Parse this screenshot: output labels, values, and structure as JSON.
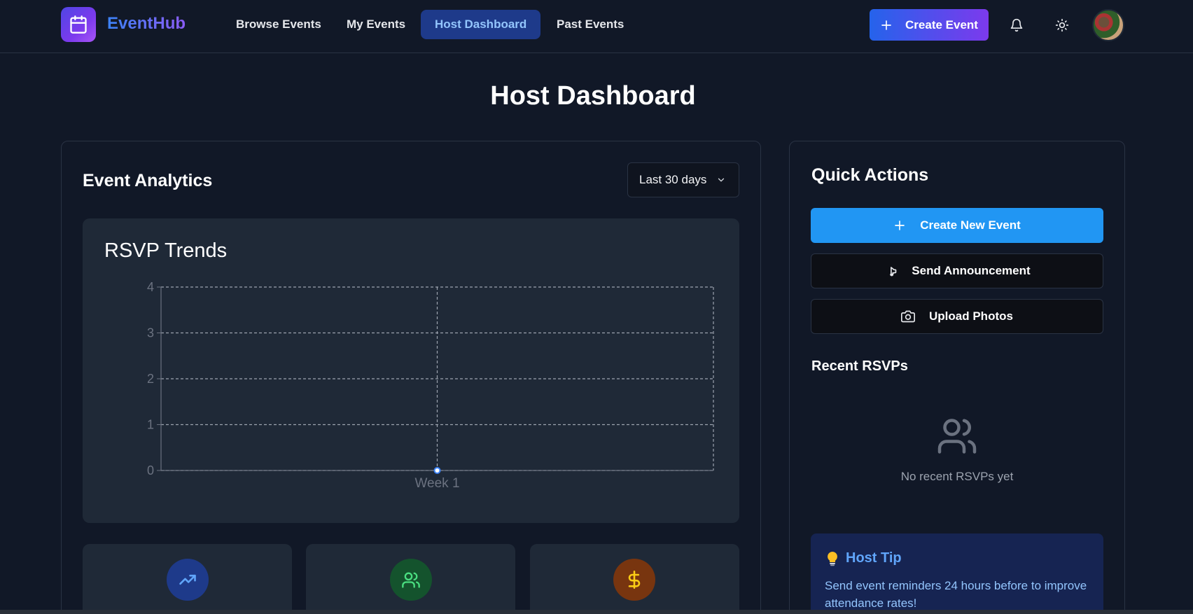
{
  "brand": {
    "name": "EventHub"
  },
  "nav": {
    "items": [
      {
        "label": "Browse Events"
      },
      {
        "label": "My Events"
      },
      {
        "label": "Host Dashboard"
      },
      {
        "label": "Past Events"
      }
    ],
    "active": "Host Dashboard",
    "create_label": "Create Event"
  },
  "header_icons": [
    "bell-icon",
    "sun-icon",
    "avatar"
  ],
  "page": {
    "title": "Host Dashboard"
  },
  "analytics": {
    "title": "Event Analytics",
    "range": "Last 30 days"
  },
  "chart_data": {
    "type": "line",
    "title": "RSVP Trends",
    "categories": [
      "Week 1"
    ],
    "series": [
      {
        "values": [
          0
        ]
      }
    ],
    "ylim": [
      0,
      4
    ],
    "yticks": [
      "0",
      "1",
      "2",
      "3",
      "4"
    ],
    "grid": true,
    "xlabel": "",
    "ylabel": ""
  },
  "stats_icons": [
    "trending-up-icon",
    "users-icon",
    "dollar-icon"
  ],
  "quick_actions": {
    "title": "Quick Actions",
    "buttons": [
      {
        "label": "Create New Event",
        "icon": "plus-icon"
      },
      {
        "label": "Send Announcement",
        "icon": "megaphone-icon"
      },
      {
        "label": "Upload Photos",
        "icon": "camera-icon"
      }
    ]
  },
  "recent_rsvps": {
    "title": "Recent RSVPs",
    "empty_text": "No recent RSVPs yet"
  },
  "tip": {
    "title": "Host Tip",
    "text": "Send event reminders 24 hours before to improve attendance rates!"
  },
  "colors": {
    "background": "#111827",
    "card": "#1f2937",
    "accent_blue": "#2196f3",
    "active_nav": "#1e3a8a",
    "tip_bg": "#172554"
  }
}
